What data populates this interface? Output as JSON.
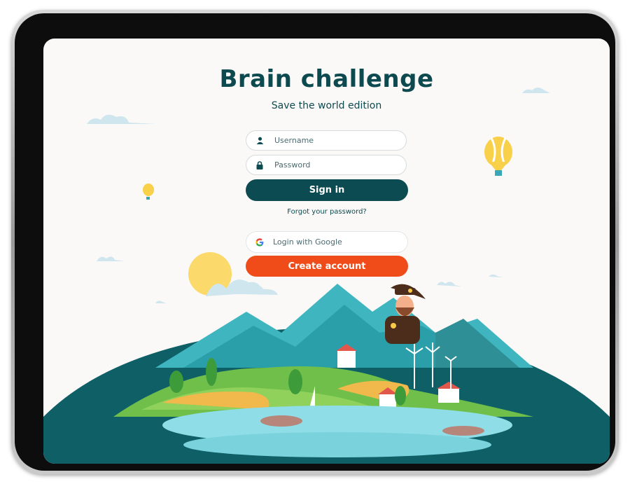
{
  "app": {
    "title": "Brain challenge",
    "subtitle": "Save the world edition"
  },
  "login": {
    "username_placeholder": "Username",
    "username_value": "",
    "password_placeholder": "Password",
    "password_value": "",
    "signin_label": "Sign in",
    "forgot_label": "Forgot your password?",
    "google_label": "Login with Google",
    "create_label": "Create account"
  },
  "icons": {
    "username": "user-icon",
    "password": "lock-icon",
    "google": "google-icon"
  },
  "colors": {
    "brand_dark": "#0c4b52",
    "accent_orange": "#f04c1a",
    "background": "#fbf9f7"
  }
}
